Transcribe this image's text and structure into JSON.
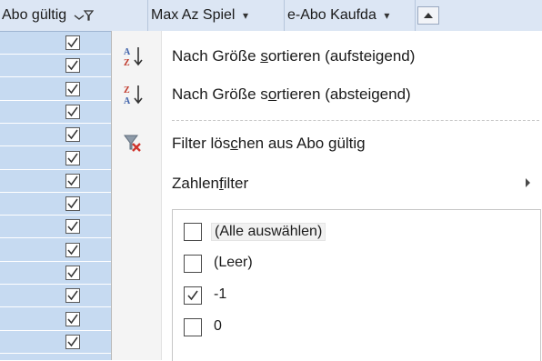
{
  "header": {
    "columns": [
      {
        "label": "Abo gültig",
        "icon": "filter-dropdown-icon"
      },
      {
        "label": "Max Az Spiel",
        "icon": "dropdown-arrow-icon"
      },
      {
        "label": "e-Abo Kaufda",
        "icon": "dropdown-arrow-icon"
      }
    ],
    "filter_glyph": "⊻",
    "dd_glyph": "▾",
    "sort_button_icon": "sort-triangle-up-icon"
  },
  "left_column": {
    "checked_rows": 14
  },
  "menu": {
    "items": [
      {
        "pre": "Nach Größe ",
        "ul": "s",
        "post": "ortieren (aufsteigend)",
        "icon": "sort-az-icon"
      },
      {
        "pre": "Nach Größe s",
        "ul": "o",
        "post": "rtieren (absteigend)",
        "icon": "sort-za-icon"
      },
      {
        "pre": "Filter lös",
        "ul": "c",
        "post": "hen aus Abo gültig",
        "icon": "clear-filter-icon"
      },
      {
        "pre": "Zahlen",
        "ul": "f",
        "post": "ilter",
        "icon": "submenu-arrow-icon"
      }
    ],
    "values": [
      {
        "label": "(Alle auswählen)",
        "checked": false
      },
      {
        "label": "(Leer)",
        "checked": false
      },
      {
        "label": "-1",
        "checked": true
      },
      {
        "label": "0",
        "checked": false
      }
    ]
  },
  "colors": {
    "header_bg": "#dce6f4",
    "cell_bg": "#c6daf1",
    "gutter_bg": "#f4f4f4",
    "az_blue": "#3b5fa8",
    "za_red": "#c0392b",
    "filter_red": "#d0342c"
  }
}
